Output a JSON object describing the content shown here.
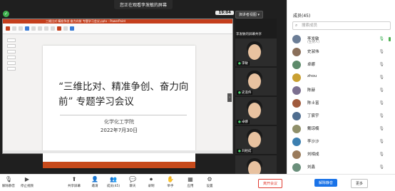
{
  "meeting": {
    "banner": "您正在观看李发敏的屏幕",
    "time": "19:04",
    "view_button": "演讲者视图",
    "shared_window_title": "三维比对 精准争创 奋力向前 专题学习会议.pptx - PowerPoint"
  },
  "slide": {
    "title": "“三维比对、精准争创、奋力向前” 专题学习会议",
    "org": "化学化工学院",
    "date": "2022年7月30日"
  },
  "video_strip": {
    "screen_tag": "李发敏的屏幕共享",
    "tiles": [
      {
        "name": "李敏"
      },
      {
        "name": "史淑伟"
      },
      {
        "name": "卓娜"
      },
      {
        "name": "刘相成"
      },
      {
        "name": ""
      }
    ]
  },
  "toolbar": {
    "items": [
      {
        "label": "解除静音",
        "icon": "mic-muted-icon"
      },
      {
        "label": "停止视频",
        "icon": "video-icon"
      },
      {
        "label": "共享屏幕",
        "icon": "share-screen-icon"
      },
      {
        "label": "邀请",
        "icon": "invite-icon"
      },
      {
        "label": "成员(45)",
        "icon": "members-icon"
      },
      {
        "label": "聊天",
        "icon": "chat-icon"
      },
      {
        "label": "录制",
        "icon": "record-icon"
      },
      {
        "label": "举手",
        "icon": "raise-hand-icon"
      },
      {
        "label": "应用",
        "icon": "apps-icon"
      },
      {
        "label": "设置",
        "icon": "settings-icon"
      }
    ],
    "leave": "离开会议",
    "unmute_all": "解除静音",
    "more": "更多"
  },
  "panel": {
    "title": "成员(45)",
    "search_placeholder": "搜索成员",
    "members": [
      {
        "name": "李发敏",
        "role": "(主持人)",
        "mic": "on",
        "avatar_color": "#6b7d96"
      },
      {
        "name": "史淑伟",
        "role": "",
        "mic": "off",
        "avatar_color": "#8a6f5a"
      },
      {
        "name": "卓娜",
        "role": "",
        "mic": "off",
        "avatar_color": "#5d8a6a"
      },
      {
        "name": "zhou",
        "role": "",
        "mic": "off",
        "avatar_color": "#c9a032"
      },
      {
        "name": "陈赫",
        "role": "",
        "mic": "off",
        "avatar_color": "#7b6f8f"
      },
      {
        "name": "陈士富",
        "role": "",
        "mic": "off",
        "avatar_color": "#a05a3c"
      },
      {
        "name": "丁宸宇",
        "role": "",
        "mic": "off",
        "avatar_color": "#4f6d8f"
      },
      {
        "name": "戴琼楠",
        "role": "",
        "mic": "off",
        "avatar_color": "#8f8f6a"
      },
      {
        "name": "李沙沙",
        "role": "",
        "mic": "off",
        "avatar_color": "#3c7fb0"
      },
      {
        "name": "刘相成",
        "role": "",
        "mic": "off",
        "avatar_color": "#9a7b5c"
      },
      {
        "name": "刘鑫",
        "role": "",
        "mic": "off",
        "avatar_color": "#6a8f7b"
      }
    ]
  }
}
